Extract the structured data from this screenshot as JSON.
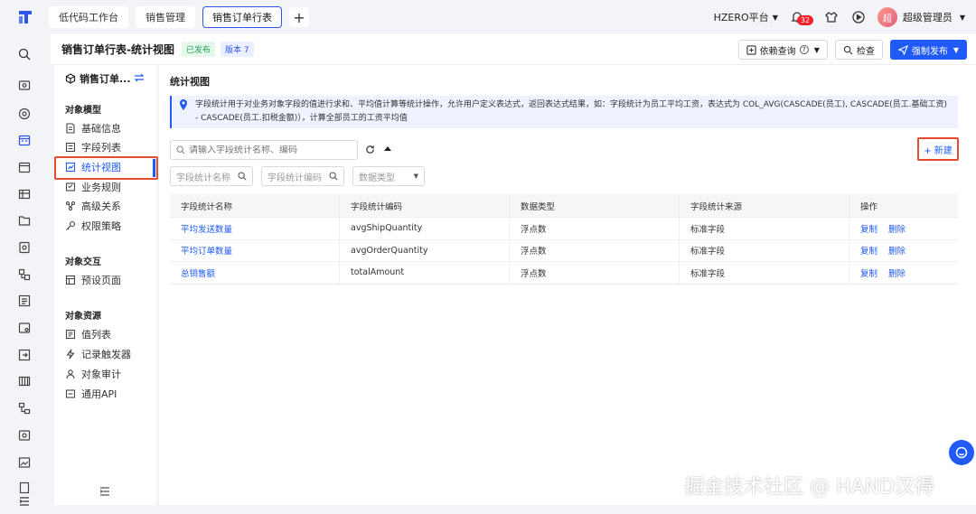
{
  "topbar": {
    "tabs": [
      {
        "label": "低代码工作台"
      },
      {
        "label": "销售管理"
      },
      {
        "label": "销售订单行表"
      }
    ],
    "platform": "HZERO平台",
    "notification_count": "32",
    "avatar_text": "超",
    "username": "超级管理员"
  },
  "header": {
    "title": "销售订单行表-统计视图",
    "status": "已发布",
    "version": "版本 7",
    "dependency_label": "依赖查询",
    "check_label": "检查",
    "publish_label": "强制发布"
  },
  "object_panel": {
    "title": "销售订单...",
    "sections": [
      {
        "title": "对象模型",
        "items": [
          "基础信息",
          "字段列表",
          "统计视图",
          "业务规则",
          "高级关系",
          "权限策略"
        ]
      },
      {
        "title": "对象交互",
        "items": [
          "预设页面"
        ]
      },
      {
        "title": "对象资源",
        "items": [
          "值列表",
          "记录触发器",
          "对象审计",
          "通用API"
        ]
      }
    ]
  },
  "main": {
    "title": "统计视图",
    "info": "字段统计用于对业务对象字段的值进行求和、平均值计算等统计操作，允许用户定义表达式，返回表达式结果，如：字段统计为员工平均工资，表达式为 COL_AVG(CASCADE(员工), CASCADE(员工.基础工资) - CASCADE(员工.扣税金额)），计算全部员工的工资平均值",
    "search_placeholder": "请输入字段统计名称、编码",
    "new_label": "+ 新建",
    "filters": {
      "name": "字段统计名称",
      "code": "字段统计编码",
      "type": "数据类型"
    },
    "table": {
      "headers": [
        "字段统计名称",
        "字段统计编码",
        "数据类型",
        "字段统计来源",
        "操作"
      ],
      "rows": [
        {
          "name": "平均发送数量",
          "code": "avgShipQuantity",
          "type": "浮点数",
          "source": "标准字段",
          "copy": "复制",
          "delete": "删除"
        },
        {
          "name": "平均订单数量",
          "code": "avgOrderQuantity",
          "type": "浮点数",
          "source": "标准字段",
          "copy": "复制",
          "delete": "删除"
        },
        {
          "name": "总销售额",
          "code": "totalAmount",
          "type": "浮点数",
          "source": "标准字段",
          "copy": "复制",
          "delete": "删除"
        }
      ]
    }
  },
  "watermark": "掘金技术社区 @ HAND汉得",
  "colors": {
    "accent": "#1f5af7",
    "highlight": "#e64a32",
    "published": "#21a35b"
  }
}
